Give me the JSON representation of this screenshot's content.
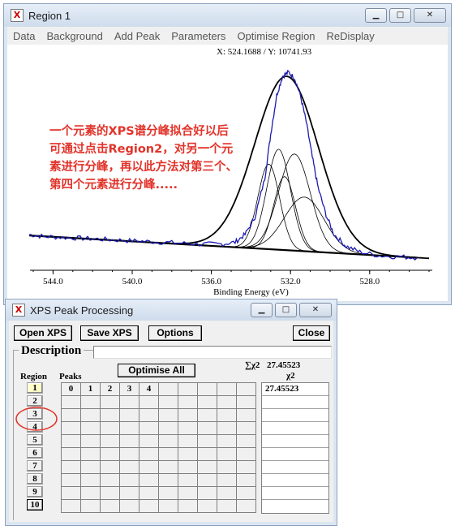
{
  "window1": {
    "title": "Region 1",
    "menu": [
      "Data",
      "Background",
      "Add Peak",
      "Parameters",
      "Optimise Region",
      "ReDisplay"
    ],
    "coord_readout": "X: 524.1688 / Y: 10741.93",
    "annotation_lines": [
      "一个元素的XPS谱分峰拟合好以后",
      "可通过点击Region2，对另一个元",
      "素进行分峰，再以此方法对第三个、",
      "第四个元素进行分峰....."
    ],
    "annotation_color": "#e2332a"
  },
  "chart_data": {
    "type": "line",
    "xlabel": "Binding Energy (eV)",
    "x_reversed": true,
    "xlim": [
      545,
      525
    ],
    "x_ticks": [
      {
        "value": 544,
        "label": "544.0"
      },
      {
        "value": 540,
        "label": "540.0"
      },
      {
        "value": 536,
        "label": "536.0"
      },
      {
        "value": 532,
        "label": "532.0"
      },
      {
        "value": 528,
        "label": "528.0"
      }
    ],
    "ylabel": "",
    "y_axis_shown": false,
    "series": [
      {
        "role": "data",
        "color": "#1b1bb0",
        "x": [
          545.2,
          544.5,
          543.5,
          542.5,
          541.5,
          540.5,
          539.5,
          538.5,
          537.5,
          536.5,
          535.5,
          534.8,
          534.3,
          533.8,
          533.3,
          533.0,
          532.7,
          532.4,
          532.1,
          531.8,
          531.5,
          531.2,
          530.9,
          530.6,
          530.2,
          529.8,
          529.2,
          528.5,
          527.5,
          526.5,
          525.6
        ],
        "y": [
          0.16,
          0.15,
          0.145,
          0.14,
          0.135,
          0.13,
          0.125,
          0.12,
          0.115,
          0.11,
          0.11,
          0.12,
          0.16,
          0.25,
          0.45,
          0.68,
          0.88,
          0.98,
          1.0,
          0.97,
          0.88,
          0.74,
          0.56,
          0.4,
          0.26,
          0.16,
          0.1,
          0.07,
          0.05,
          0.045,
          0.04
        ]
      },
      {
        "role": "envelope",
        "color": "#000000",
        "center": 532.2,
        "amplitude": 0.9,
        "width": 1.6
      },
      {
        "role": "peak",
        "color": "#000000",
        "center": 533.1,
        "amplitude": 0.44,
        "width": 0.55
      },
      {
        "role": "peak",
        "color": "#000000",
        "center": 532.6,
        "amplitude": 0.52,
        "width": 0.6
      },
      {
        "role": "peak",
        "color": "#000000",
        "center": 532.3,
        "amplitude": 0.38,
        "width": 0.55
      },
      {
        "role": "peak",
        "color": "#000000",
        "center": 531.8,
        "amplitude": 0.5,
        "width": 0.8
      },
      {
        "role": "peak",
        "color": "#000000",
        "center": 531.3,
        "amplitude": 0.28,
        "width": 1.0
      }
    ],
    "background": {
      "x": [
        545.2,
        525.6
      ],
      "y": [
        0.155,
        0.04
      ]
    }
  },
  "window2": {
    "title": "XPS Peak Processing",
    "buttons": {
      "open_xps": "Open XPS",
      "save_xps": "Save XPS",
      "options": "Options",
      "close": "Close"
    },
    "description_label": "Description",
    "description_value": "",
    "region_label": "Region",
    "peaks_label": "Peaks",
    "optimise_all": "Optimise All",
    "sum_chi_label": "∑χ2",
    "sum_chi_value": "27.45523",
    "chi_label": "χ2",
    "peak_headers": [
      "0",
      "1",
      "2",
      "3",
      "4",
      "",
      "",
      "",
      "",
      ""
    ],
    "regions": [
      "1",
      "2",
      "3",
      "4",
      "5",
      "6",
      "7",
      "8",
      "9",
      "10"
    ],
    "active_region": "1",
    "highlight_region": "2",
    "chi_values": [
      "27.45523",
      "",
      "",
      "",
      "",
      "",
      "",
      "",
      "",
      ""
    ],
    "highlight_color": "#e2332a"
  }
}
